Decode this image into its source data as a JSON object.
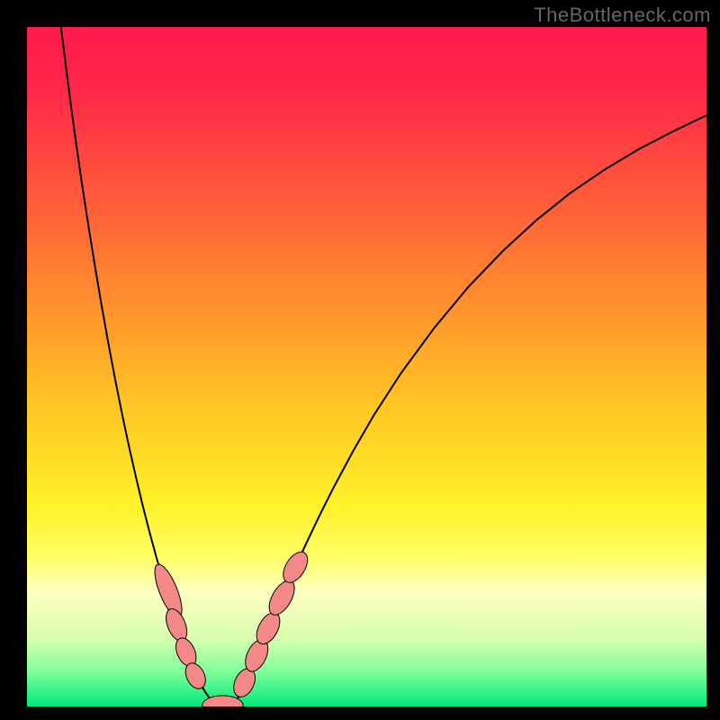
{
  "watermark": "TheBottleneck.com",
  "chart_data": {
    "type": "line",
    "title": "",
    "xlabel": "",
    "ylabel": "",
    "xlim": [
      0,
      100
    ],
    "ylim": [
      0,
      100
    ],
    "background_gradient": {
      "stops": [
        {
          "offset": 0.0,
          "color": "#ff1a4b"
        },
        {
          "offset": 0.1,
          "color": "#ff2a48"
        },
        {
          "offset": 0.25,
          "color": "#ff5a3a"
        },
        {
          "offset": 0.4,
          "color": "#ff8e2e"
        },
        {
          "offset": 0.55,
          "color": "#ffc324"
        },
        {
          "offset": 0.7,
          "color": "#fff028"
        },
        {
          "offset": 0.78,
          "color": "#ffff66"
        },
        {
          "offset": 0.83,
          "color": "#ffffc0"
        },
        {
          "offset": 0.9,
          "color": "#d8ffb0"
        },
        {
          "offset": 0.95,
          "color": "#7dff9a"
        },
        {
          "offset": 1.0,
          "color": "#00e878"
        }
      ]
    },
    "series": [
      {
        "name": "bottleneck-curve",
        "stroke": "#000000",
        "stroke_width": 2,
        "points": [
          [
            5.0,
            100.0
          ],
          [
            6.0,
            92.0
          ],
          [
            7.0,
            84.5
          ],
          [
            8.0,
            77.5
          ],
          [
            9.0,
            71.0
          ],
          [
            10.0,
            64.8
          ],
          [
            11.0,
            58.9
          ],
          [
            12.0,
            53.3
          ],
          [
            13.0,
            48.0
          ],
          [
            14.0,
            43.0
          ],
          [
            15.0,
            38.3
          ],
          [
            16.0,
            33.9
          ],
          [
            17.0,
            29.7
          ],
          [
            18.0,
            25.8
          ],
          [
            19.0,
            22.1
          ],
          [
            20.0,
            18.7
          ],
          [
            21.0,
            15.5
          ],
          [
            22.0,
            12.5
          ],
          [
            23.0,
            9.7
          ],
          [
            24.0,
            7.1
          ],
          [
            25.0,
            4.7
          ],
          [
            26.0,
            2.5
          ],
          [
            27.0,
            1.0
          ],
          [
            27.5,
            0.4
          ],
          [
            28.0,
            0.0
          ],
          [
            29.0,
            0.0
          ],
          [
            30.0,
            0.0
          ],
          [
            30.5,
            0.4
          ],
          [
            31.0,
            1.2
          ],
          [
            32.0,
            3.0
          ],
          [
            33.0,
            5.2
          ],
          [
            34.0,
            7.6
          ],
          [
            35.0,
            10.0
          ],
          [
            37.0,
            14.8
          ],
          [
            39.0,
            19.4
          ],
          [
            41.0,
            23.8
          ],
          [
            43.0,
            28.0
          ],
          [
            45.0,
            32.0
          ],
          [
            48.0,
            37.6
          ],
          [
            51.0,
            42.8
          ],
          [
            55.0,
            49.0
          ],
          [
            60.0,
            55.8
          ],
          [
            65.0,
            61.8
          ],
          [
            70.0,
            67.0
          ],
          [
            75.0,
            71.6
          ],
          [
            80.0,
            75.6
          ],
          [
            85.0,
            79.0
          ],
          [
            90.0,
            82.0
          ],
          [
            95.0,
            84.6
          ],
          [
            100.0,
            87.0
          ]
        ]
      }
    ],
    "markers": {
      "fill": "#f48a87",
      "stroke": "#000000",
      "items": [
        {
          "shape": "pill",
          "cx": 20.8,
          "cy": 17.0,
          "rx": 1.3,
          "ry": 4.2,
          "angle": -22
        },
        {
          "shape": "pill",
          "cx": 22.0,
          "cy": 12.0,
          "rx": 1.3,
          "ry": 2.5,
          "angle": -22
        },
        {
          "shape": "pill",
          "cx": 23.4,
          "cy": 8.0,
          "rx": 1.3,
          "ry": 2.2,
          "angle": -24
        },
        {
          "shape": "pill",
          "cx": 24.8,
          "cy": 4.5,
          "rx": 1.3,
          "ry": 2.0,
          "angle": -26
        },
        {
          "shape": "pill",
          "cx": 28.8,
          "cy": 0.2,
          "rx": 3.0,
          "ry": 1.4,
          "angle": 0
        },
        {
          "shape": "pill",
          "cx": 32.0,
          "cy": 3.5,
          "rx": 1.4,
          "ry": 2.2,
          "angle": 25
        },
        {
          "shape": "pill",
          "cx": 33.8,
          "cy": 7.5,
          "rx": 1.4,
          "ry": 2.5,
          "angle": 25
        },
        {
          "shape": "pill",
          "cx": 35.5,
          "cy": 11.5,
          "rx": 1.4,
          "ry": 2.5,
          "angle": 28
        },
        {
          "shape": "pill",
          "cx": 37.5,
          "cy": 16.0,
          "rx": 1.4,
          "ry": 2.8,
          "angle": 30
        },
        {
          "shape": "pill",
          "cx": 39.5,
          "cy": 20.5,
          "rx": 1.4,
          "ry": 2.5,
          "angle": 32
        }
      ]
    }
  }
}
